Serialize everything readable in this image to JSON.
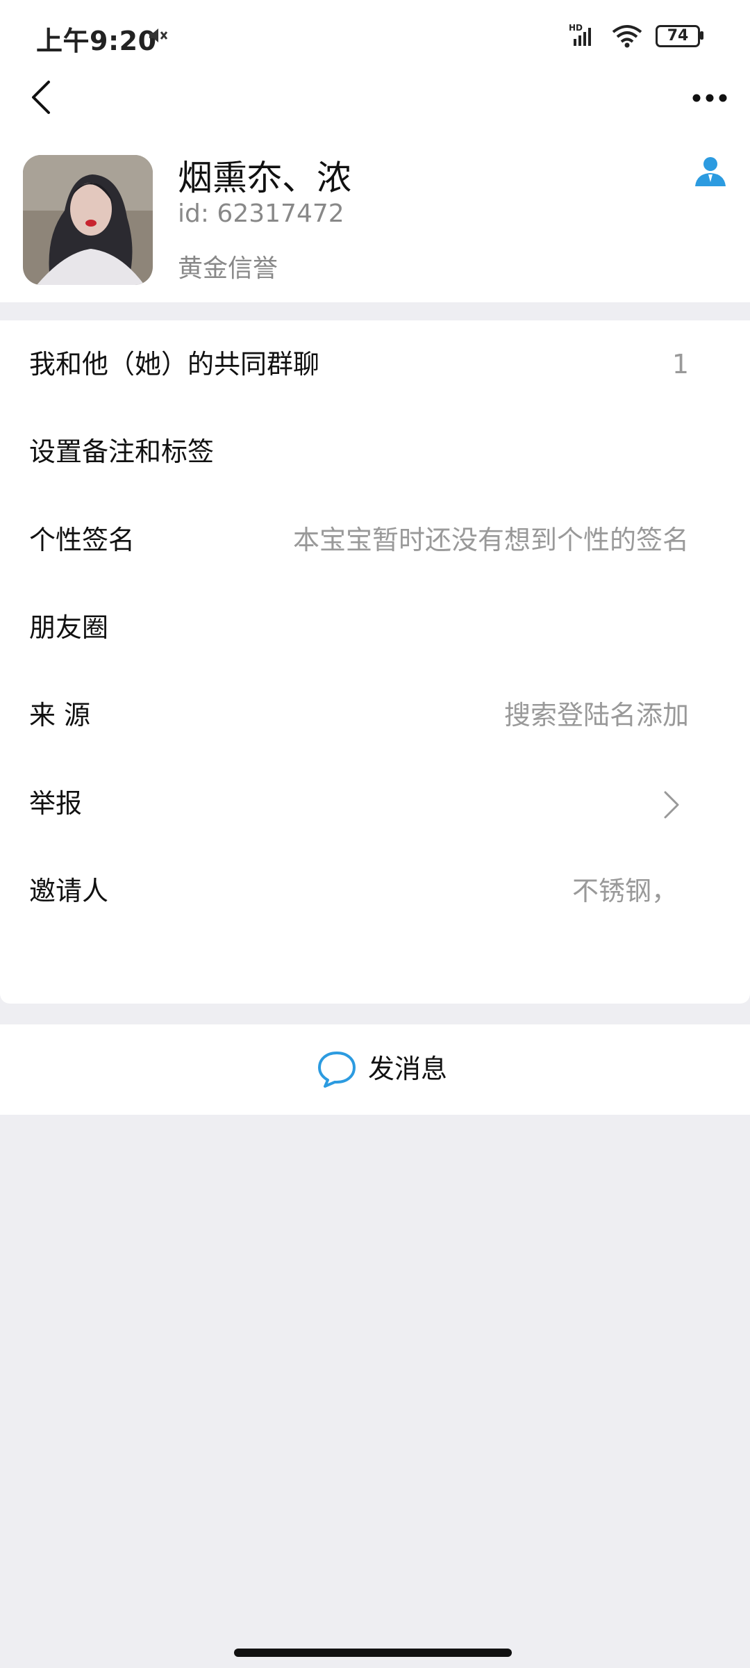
{
  "status_bar": {
    "time": "上午9:20",
    "network": "HD",
    "battery": "74"
  },
  "nav": {
    "back_icon": "chevron-left-icon",
    "more_icon": "more-horizontal-icon"
  },
  "profile": {
    "name": "烟熏夵、浓",
    "id_text": "id: 62317472",
    "credit": "黄金信誉",
    "contact_icon": "person-icon"
  },
  "rows": [
    {
      "label": "我和他（她）的共同群聊",
      "value": "1"
    },
    {
      "label": "设置备注和标签",
      "value": ""
    },
    {
      "label": "个性签名",
      "value": "本宝宝暂时还没有想到个性的签名"
    },
    {
      "label": "朋友圈",
      "value": ""
    },
    {
      "label": "来 源",
      "value": "搜索登陆名添加"
    },
    {
      "label": "举报",
      "value": ""
    },
    {
      "label": "邀请人",
      "value": "不锈钢，"
    }
  ],
  "send_message": {
    "label": "发消息",
    "icon": "chat-bubble-icon"
  },
  "colors": {
    "accent": "#2C9BE0",
    "background": "#EEEEF2",
    "secondary_text": "#999999"
  }
}
